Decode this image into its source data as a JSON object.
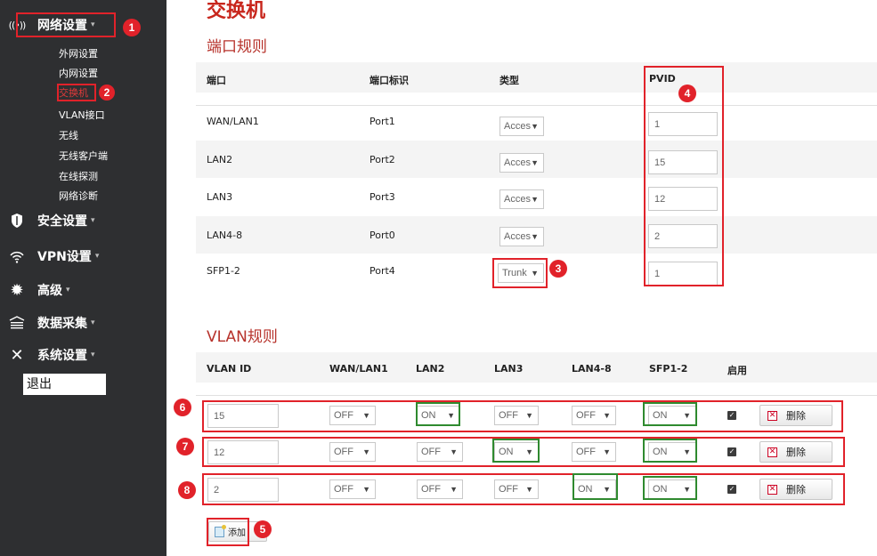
{
  "page": {
    "title": "交换机"
  },
  "sidebar": {
    "menus": [
      {
        "label": "网络设置",
        "icon": "wireless-icon"
      },
      {
        "label": "安全设置",
        "icon": "shield-icon"
      },
      {
        "label": "VPN设置",
        "icon": "wifi-signal-icon"
      },
      {
        "label": "高级",
        "icon": "gear-icon"
      },
      {
        "label": "数据采集",
        "icon": "data-collection-icon"
      },
      {
        "label": "系统设置",
        "icon": "tools-icon"
      }
    ],
    "sub_items": [
      "外网设置",
      "内网设置",
      "交换机",
      "VLAN接口",
      "无线",
      "无线客户端",
      "在线探测",
      "网络诊断"
    ],
    "logout": "退出"
  },
  "port_rules": {
    "title": "端口规则",
    "headers": {
      "port": "端口",
      "port_id": "端口标识",
      "type": "类型",
      "pvid": "PVID"
    },
    "rows": [
      {
        "port": "WAN/LAN1",
        "id": "Port1",
        "type": "Acces",
        "pvid": "1"
      },
      {
        "port": "LAN2",
        "id": "Port2",
        "type": "Acces",
        "pvid": "15"
      },
      {
        "port": "LAN3",
        "id": "Port3",
        "type": "Acces",
        "pvid": "12"
      },
      {
        "port": "LAN4-8",
        "id": "Port0",
        "type": "Acces",
        "pvid": "2"
      },
      {
        "port": "SFP1-2",
        "id": "Port4",
        "type": "Trunk",
        "pvid": "1"
      }
    ]
  },
  "vlan_rules": {
    "title": "VLAN规则",
    "headers": {
      "vlan_id": "VLAN ID",
      "wan_lan1": "WAN/LAN1",
      "lan2": "LAN2",
      "lan3": "LAN3",
      "lan4_8": "LAN4-8",
      "sfp": "SFP1-2",
      "enable": "启用"
    },
    "rows": [
      {
        "id": "15",
        "wan_lan1": "OFF",
        "lan2": "ON",
        "lan3": "OFF",
        "lan4_8": "OFF",
        "sfp": "ON",
        "enabled": true,
        "delete": "删除"
      },
      {
        "id": "12",
        "wan_lan1": "OFF",
        "lan2": "OFF",
        "lan3": "ON",
        "lan4_8": "OFF",
        "sfp": "ON",
        "enabled": true,
        "delete": "删除"
      },
      {
        "id": "2",
        "wan_lan1": "OFF",
        "lan2": "OFF",
        "lan3": "OFF",
        "lan4_8": "ON",
        "sfp": "ON",
        "enabled": true,
        "delete": "删除"
      }
    ],
    "add_button": "添加"
  },
  "annotations": [
    "1",
    "2",
    "3",
    "4",
    "5",
    "6",
    "7",
    "8"
  ],
  "colors": {
    "sidebar_bg": "#2e2f31",
    "accent_red": "#e1222a",
    "highlight_green": "#2f8a2f",
    "title_red": "#c8261c"
  }
}
